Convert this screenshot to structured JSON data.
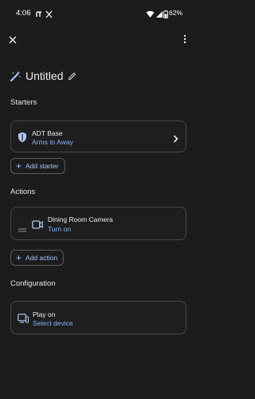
{
  "status_bar": {
    "time": "4:06",
    "battery": "62%"
  },
  "header": {
    "title": "Untitled"
  },
  "starters": {
    "section_label": "Starters",
    "card": {
      "title": "ADT Base",
      "subtitle": "Arms to Away"
    },
    "add_label": "Add starter"
  },
  "actions": {
    "section_label": "Actions",
    "card": {
      "title": "Dining Room Camera",
      "subtitle": "Turn on"
    },
    "add_label": "Add action"
  },
  "configuration": {
    "section_label": "Configuration",
    "card": {
      "title": "Play on",
      "subtitle": "Select device"
    }
  },
  "colors": {
    "background": "#1c1c1c",
    "accent": "#8ab4f8",
    "border": "#4a4a4a"
  },
  "icons": [
    "close-icon",
    "more-vert-icon",
    "magic-wand-icon",
    "pencil-icon",
    "shield-icon",
    "chevron-right-icon",
    "drag-handle-icon",
    "camera-icon",
    "plus-icon",
    "cast-device-icon"
  ]
}
